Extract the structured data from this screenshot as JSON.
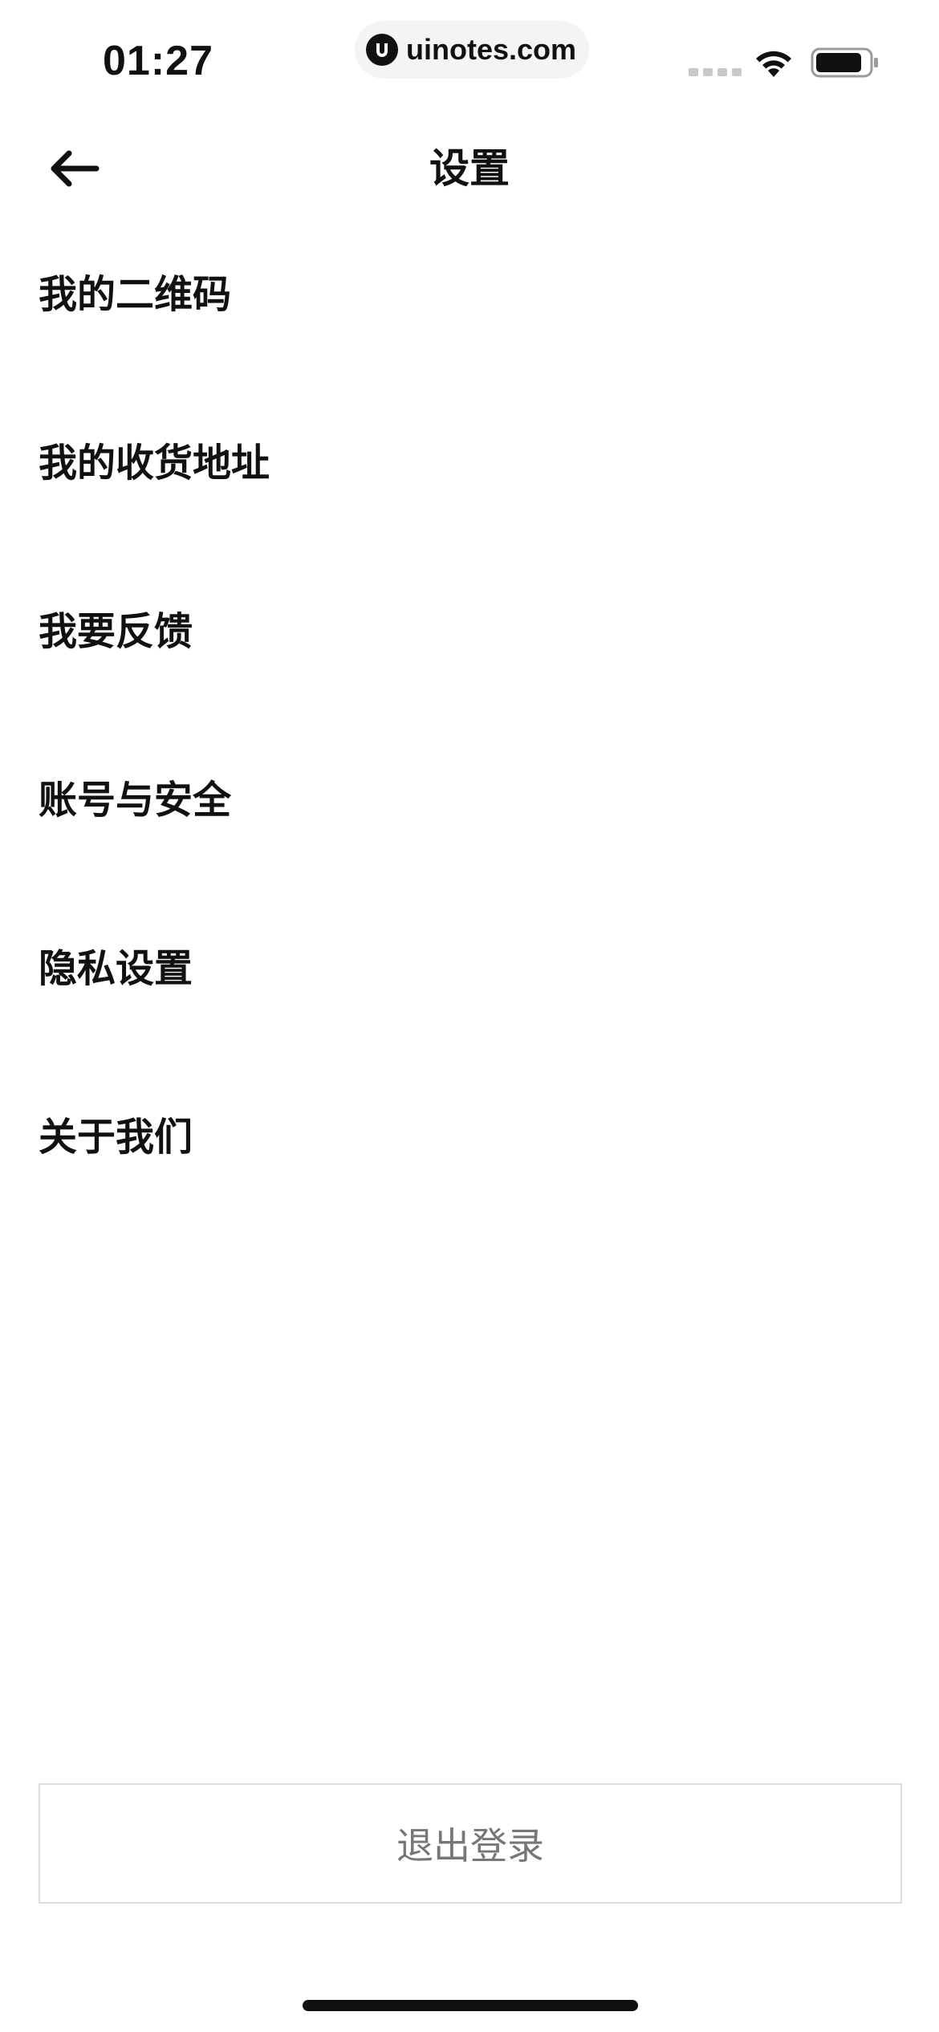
{
  "status_bar": {
    "time": "01:27",
    "url": "uinotes.com"
  },
  "nav": {
    "title": "设置",
    "back_icon": "arrow-left-icon"
  },
  "menu": {
    "items": [
      {
        "label": "我的二维码"
      },
      {
        "label": "我的收货地址"
      },
      {
        "label": "我要反馈"
      },
      {
        "label": "账号与安全"
      },
      {
        "label": "隐私设置"
      },
      {
        "label": "关于我们"
      }
    ]
  },
  "logout": {
    "label": "退出登录"
  },
  "colors": {
    "text": "#111111",
    "logout_text": "#777777",
    "logout_border": "#dcdcdc",
    "background": "#ffffff"
  }
}
